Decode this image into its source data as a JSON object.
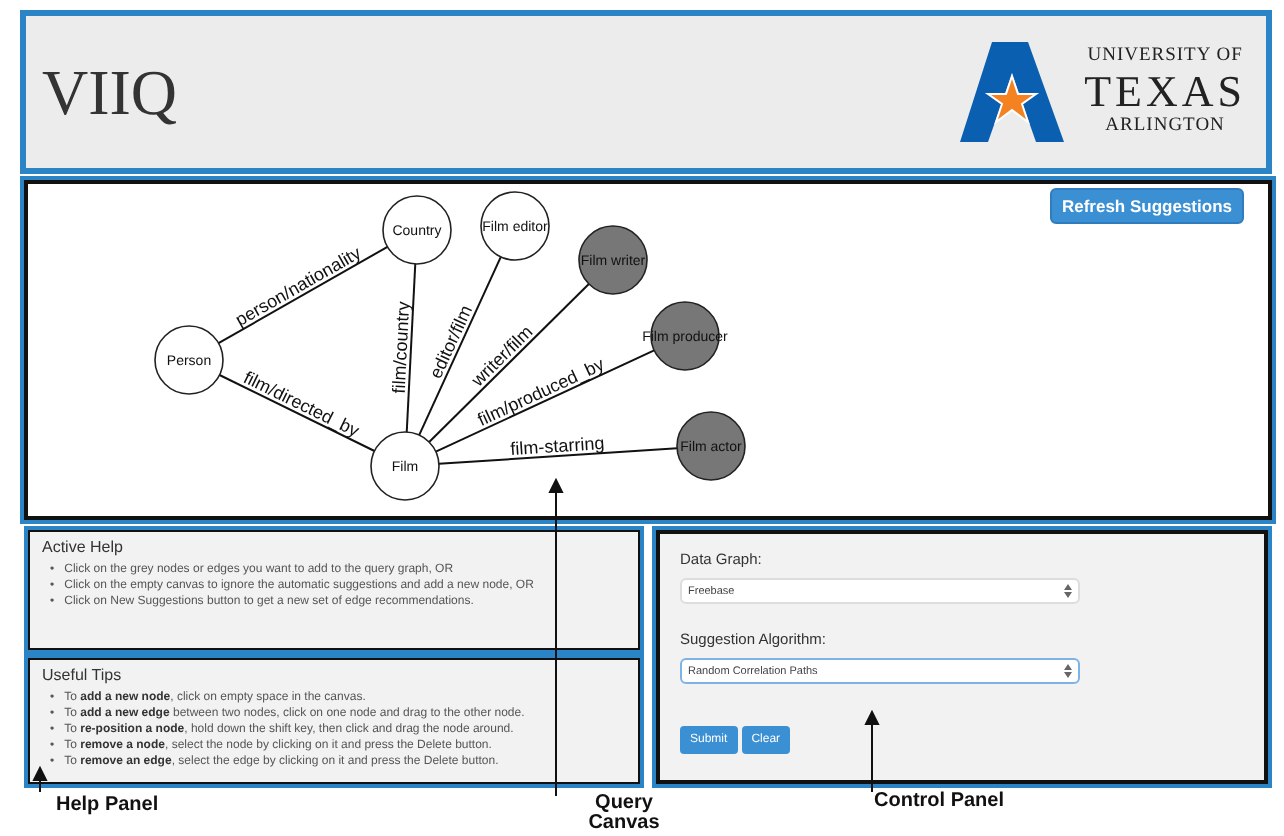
{
  "header": {
    "title": "VIIQ",
    "logo": {
      "line_1": "UNIVERSITY OF",
      "line_2": "TEXAS",
      "line_3": "ARLINGTON"
    }
  },
  "canvas": {
    "refresh_button": "Refresh Suggestions",
    "nodes": [
      {
        "label": "Person",
        "suggested": false
      },
      {
        "label": "Country",
        "suggested": false
      },
      {
        "label": "Film editor",
        "suggested": false
      },
      {
        "label": "Film writer",
        "suggested": true
      },
      {
        "label": "Film producer",
        "suggested": true
      },
      {
        "label": "Film",
        "suggested": false
      },
      {
        "label": "Film actor",
        "suggested": true
      }
    ],
    "edges": [
      {
        "label": "person/nationality"
      },
      {
        "label": "film/directed_by"
      },
      {
        "label": "film/country"
      },
      {
        "label": "editor/film"
      },
      {
        "label": "writer/film"
      },
      {
        "label": "film/produced_by"
      },
      {
        "label": "film-starring"
      }
    ]
  },
  "active_help": {
    "title": "Active Help",
    "bullet": "•",
    "items": [
      "Click on the grey nodes or edges you want to add to the query graph, OR",
      "Click on the empty canvas to ignore the automatic suggestions and add a new node, OR",
      "Click on New Suggestions button to get a new set of edge recommendations."
    ]
  },
  "useful_tips": {
    "title": "Useful Tips",
    "bullet": "•",
    "items": [
      "To **add a new node**, click on empty space in the canvas.",
      "To **add a new edge** between two nodes, click on one node and drag to the other node.",
      "To **re-position a node**, hold down the shift key, then click and drag the node around.",
      "To **remove a node**, select the node by clicking on it and press the Delete button.",
      "To **remove an edge**, select the edge by clicking on it and press the Delete button."
    ]
  },
  "control_panel": {
    "data_graph_label": "Data Graph:",
    "data_graph_value": "Freebase",
    "algorithm_label": "Suggestion Algorithm:",
    "algorithm_value": "Random Correlation Paths",
    "buttons": [
      "Submit",
      "Clear"
    ]
  },
  "annotations": [
    {
      "kind": "help",
      "text": "Help Panel"
    },
    {
      "kind": "canvas",
      "text": "Query Canvas"
    },
    {
      "kind": "control",
      "text": "Control Panel"
    }
  ]
}
